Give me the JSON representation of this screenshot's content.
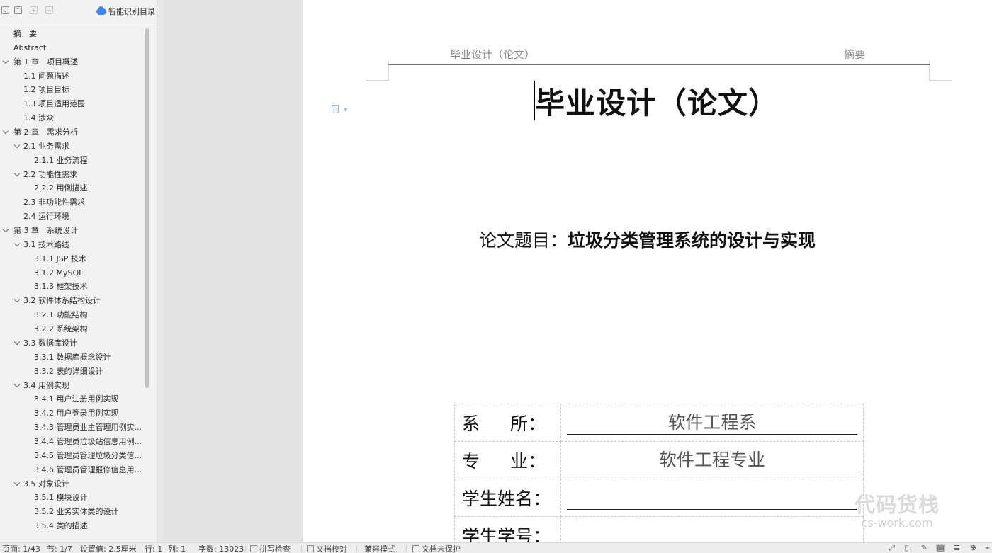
{
  "nav": {
    "toolbar": {
      "collapse_all_icon": "⌄",
      "expand_all_icon": "⌃",
      "add_icon": "+",
      "remove_icon": "−",
      "smart_toc_label": "智能识别目录"
    },
    "toc": [
      {
        "label": "摘　要",
        "level": 0,
        "expandable": false
      },
      {
        "label": "Abstract",
        "level": 0,
        "expandable": false
      },
      {
        "label": "第 1 章　项目概述",
        "level": 0,
        "expandable": true
      },
      {
        "label": "1.1  问题描述",
        "level": 1,
        "expandable": false
      },
      {
        "label": "1.2  项目目标",
        "level": 1,
        "expandable": false
      },
      {
        "label": "1.3  项目适用范围",
        "level": 1,
        "expandable": false
      },
      {
        "label": "1.4  涉众",
        "level": 1,
        "expandable": false
      },
      {
        "label": "第 2 章　需求分析",
        "level": 0,
        "expandable": true
      },
      {
        "label": "2.1  业务需求",
        "level": 1,
        "expandable": true
      },
      {
        "label": "2.1.1  业务流程",
        "level": 2,
        "expandable": false
      },
      {
        "label": "2.2  功能性需求",
        "level": 1,
        "expandable": true
      },
      {
        "label": "2.2.2  用例描述",
        "level": 2,
        "expandable": false
      },
      {
        "label": "2.3  非功能性需求",
        "level": 1,
        "expandable": false
      },
      {
        "label": "2.4  运行环境",
        "level": 1,
        "expandable": false
      },
      {
        "label": "第 3 章　系统设计",
        "level": 0,
        "expandable": true
      },
      {
        "label": "3.1  技术路线",
        "level": 1,
        "expandable": true
      },
      {
        "label": "3.1.1 JSP 技术",
        "level": 2,
        "expandable": false
      },
      {
        "label": "3.1.2 MySQL",
        "level": 2,
        "expandable": false
      },
      {
        "label": "3.1.3 框架技术",
        "level": 2,
        "expandable": false
      },
      {
        "label": "3.2  软件体系结构设计",
        "level": 1,
        "expandable": true
      },
      {
        "label": "3.2.1  功能结构",
        "level": 2,
        "expandable": false
      },
      {
        "label": "3.2.2  系统架构",
        "level": 2,
        "expandable": false
      },
      {
        "label": "3.3  数据库设计",
        "level": 1,
        "expandable": true
      },
      {
        "label": "3.3.1 数据库概念设计",
        "level": 2,
        "expandable": false
      },
      {
        "label": "3.3.2  表的详细设计",
        "level": 2,
        "expandable": false
      },
      {
        "label": "3.4  用例实现",
        "level": 1,
        "expandable": true
      },
      {
        "label": "3.4.1  用户注册用例实现",
        "level": 2,
        "expandable": false
      },
      {
        "label": "3.4.2  用户登录用例实现",
        "level": 2,
        "expandable": false
      },
      {
        "label": "3.4.3  管理员业主管理用例实...",
        "level": 2,
        "expandable": false
      },
      {
        "label": "3.4.4  管理员垃圾站信息用例...",
        "level": 2,
        "expandable": false
      },
      {
        "label": "3.4.5  管理员管理垃圾分类信...",
        "level": 2,
        "expandable": false
      },
      {
        "label": "3.4.6  管理员管理报修信息用...",
        "level": 2,
        "expandable": false
      },
      {
        "label": "3.5  对象设计",
        "level": 1,
        "expandable": true
      },
      {
        "label": "3.5.1 模块设计",
        "level": 2,
        "expandable": false
      },
      {
        "label": "3.5.2 业务实体类的设计",
        "level": 2,
        "expandable": false
      },
      {
        "label": "3.5.4 类的描述",
        "level": 2,
        "expandable": false
      }
    ]
  },
  "document": {
    "header_left": "毕业设计（论文）",
    "header_right": "摘要",
    "title": "毕业设计（论文）",
    "topic_label": "论文题目：",
    "topic_value": "垃圾分类管理系统的设计与实现",
    "info_rows": [
      {
        "label_chars": [
          "系",
          "所："
        ],
        "value": "软件工程系"
      },
      {
        "label_chars": [
          "专",
          "业："
        ],
        "value": "软件工程专业"
      },
      {
        "label": "学生姓名：",
        "value": ""
      },
      {
        "label": "学生学号：",
        "value": ""
      }
    ]
  },
  "watermark": {
    "main": "代码货栈",
    "sub": "cs-work.com"
  },
  "status_bar": {
    "page": "页面: 1/43",
    "section": "节: 1/7",
    "setting": "设置值: 2.5厘米",
    "row": "行: 1",
    "col": "列: 1",
    "word_count": "字数: 13023",
    "spell_check": "拼写检查",
    "doc_proof": "文档校对",
    "compat_mode": "兼容模式",
    "doc_unprotected": "文档未保护"
  }
}
